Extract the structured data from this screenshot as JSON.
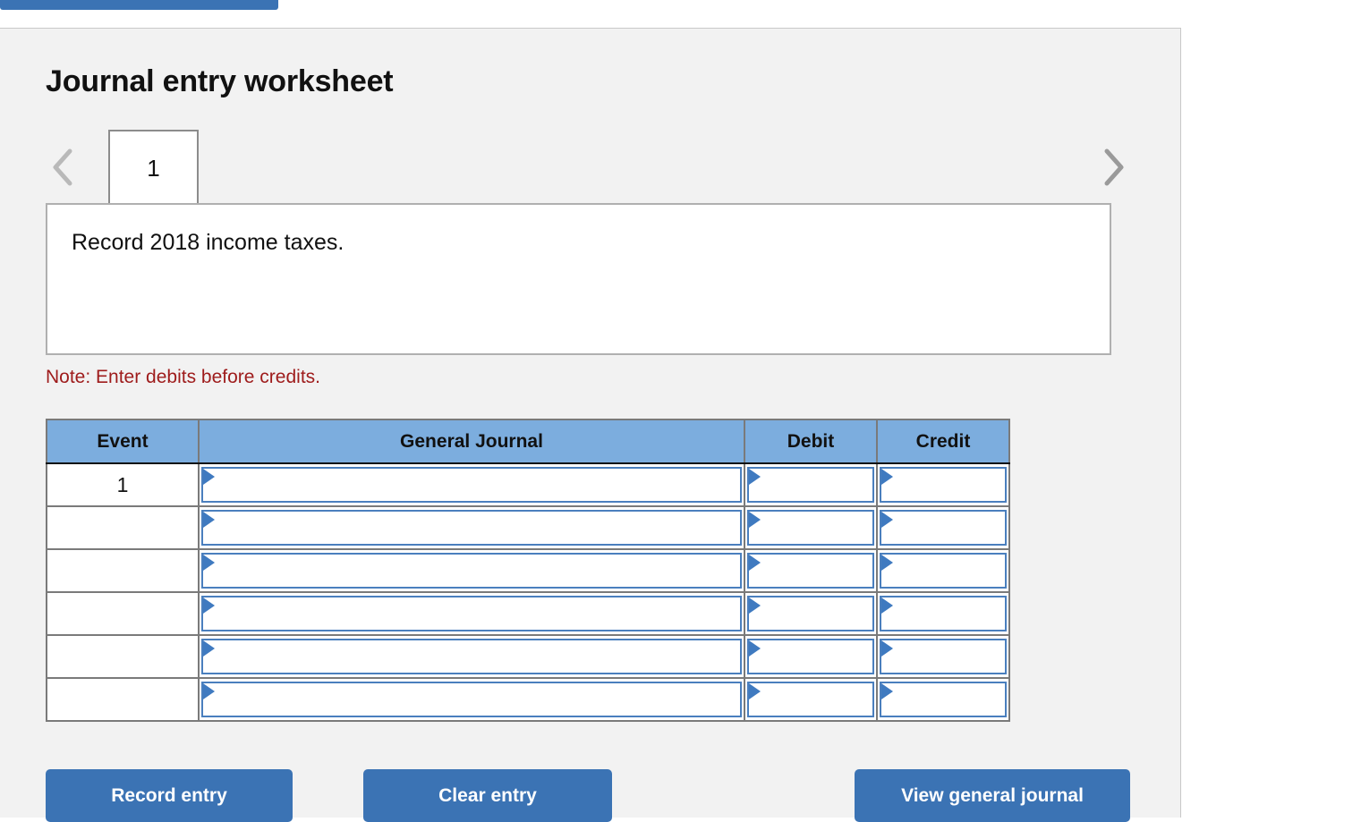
{
  "top_bar": {
    "color": "#3b73b4"
  },
  "panel": {
    "title": "Journal entry worksheet",
    "background": "#f2f2f2",
    "border_color": "#c8c8c8"
  },
  "tabs": {
    "prev_icon": "chevron-left-icon",
    "next_icon": "chevron-right-icon",
    "items": [
      {
        "label": "1",
        "selected": true
      }
    ]
  },
  "description": {
    "text": "Record 2018 income taxes."
  },
  "note": {
    "text": "Note: Enter debits before credits.",
    "color": "#9e1b1b"
  },
  "table": {
    "header_color": "#7cadde",
    "columns": [
      "Event",
      "General Journal",
      "Debit",
      "Credit"
    ],
    "rows": [
      {
        "event": "1",
        "general_journal": "",
        "debit": "",
        "credit": ""
      },
      {
        "event": "",
        "general_journal": "",
        "debit": "",
        "credit": ""
      },
      {
        "event": "",
        "general_journal": "",
        "debit": "",
        "credit": ""
      },
      {
        "event": "",
        "general_journal": "",
        "debit": "",
        "credit": ""
      },
      {
        "event": "",
        "general_journal": "",
        "debit": "",
        "credit": ""
      },
      {
        "event": "",
        "general_journal": "",
        "debit": "",
        "credit": ""
      }
    ]
  },
  "buttons": {
    "record": "Record entry",
    "clear": "Clear entry",
    "view": "View general journal",
    "color": "#3b73b4"
  }
}
